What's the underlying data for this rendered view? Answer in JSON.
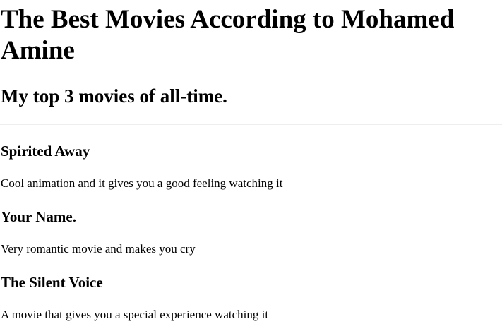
{
  "page": {
    "title": "The Best Movies According to Mohamed Amine",
    "subtitle": "My top 3 movies of all-time."
  },
  "movies": [
    {
      "title": "Spirited Away",
      "description": "Cool animation and it gives you a good feeling watching it"
    },
    {
      "title": "Your Name.",
      "description": "Very romantic movie and makes you cry"
    },
    {
      "title": "The Silent Voice",
      "description": "A movie that gives you a special experience watching it"
    }
  ]
}
